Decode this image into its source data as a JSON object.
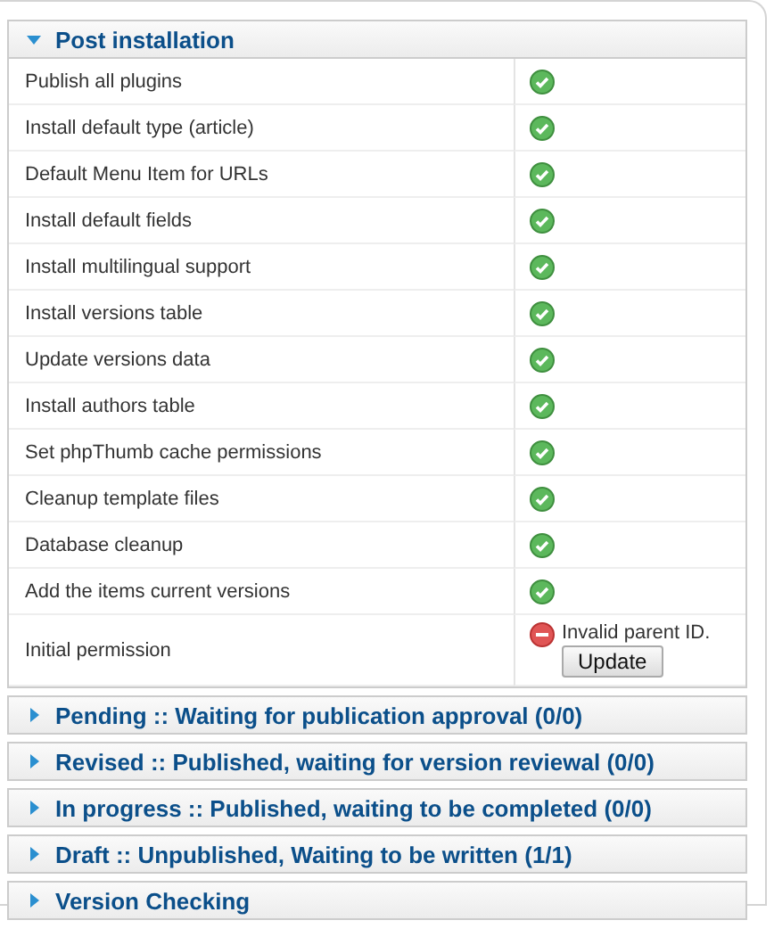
{
  "sections": [
    {
      "title": "Post installation",
      "expanded": true,
      "rows": [
        {
          "label": "Publish all plugins",
          "kind": "ok"
        },
        {
          "label": "Install default type (article)",
          "kind": "ok"
        },
        {
          "label": "Default Menu Item for URLs",
          "kind": "ok"
        },
        {
          "label": "Install default fields",
          "kind": "ok"
        },
        {
          "label": "Install multilingual support",
          "kind": "ok"
        },
        {
          "label": "Install versions table",
          "kind": "ok"
        },
        {
          "label": "Update versions data",
          "kind": "ok"
        },
        {
          "label": "Install authors table",
          "kind": "ok"
        },
        {
          "label": "Set phpThumb cache permissions",
          "kind": "ok"
        },
        {
          "label": "Cleanup template files",
          "kind": "ok"
        },
        {
          "label": "Database cleanup",
          "kind": "ok"
        },
        {
          "label": "Add the items current versions",
          "kind": "ok"
        },
        {
          "label": "Initial permission",
          "kind": "error",
          "message": "Invalid parent ID.",
          "button": "Update"
        }
      ]
    },
    {
      "title": "Pending :: Waiting for publication approval (0/0)",
      "expanded": false
    },
    {
      "title": "Revised :: Published, waiting for version reviewal (0/0)",
      "expanded": false
    },
    {
      "title": "In progress :: Published, waiting to be completed (0/0)",
      "expanded": false
    },
    {
      "title": "Draft :: Unpublished, Waiting to be written (1/1)",
      "expanded": false
    },
    {
      "title": "Version Checking",
      "expanded": false
    }
  ]
}
